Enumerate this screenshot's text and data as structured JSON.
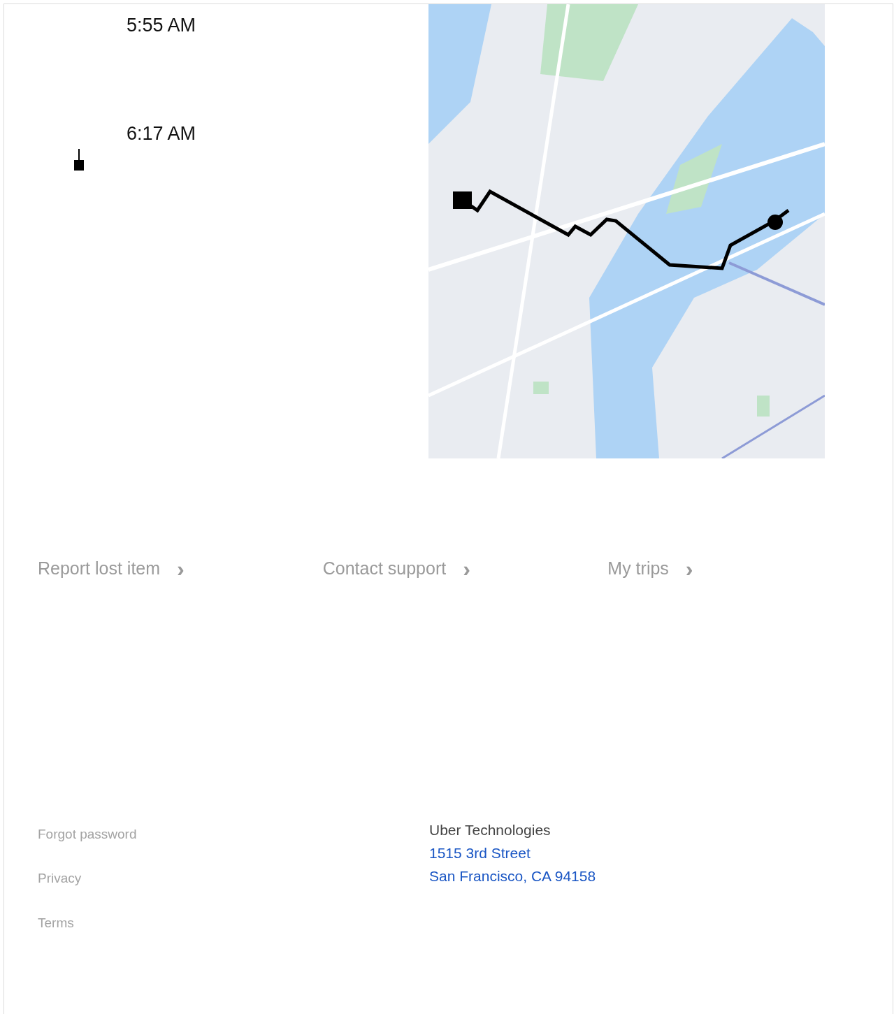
{
  "trip": {
    "times": [
      "5:55 AM",
      "6:17 AM"
    ],
    "map": {
      "kind": "picture"
    }
  },
  "links": [
    {
      "label": "Report lost item",
      "arrow": "›"
    },
    {
      "label": "Contact support",
      "arrow": "›"
    },
    {
      "label": "My trips",
      "arrow": "›"
    }
  ],
  "footer": {
    "links": [
      "Forgot password",
      "Privacy",
      "Terms"
    ],
    "company": "Uber Technologies",
    "address": [
      "1515 3rd Street",
      "San Francisco, CA 94158"
    ]
  }
}
